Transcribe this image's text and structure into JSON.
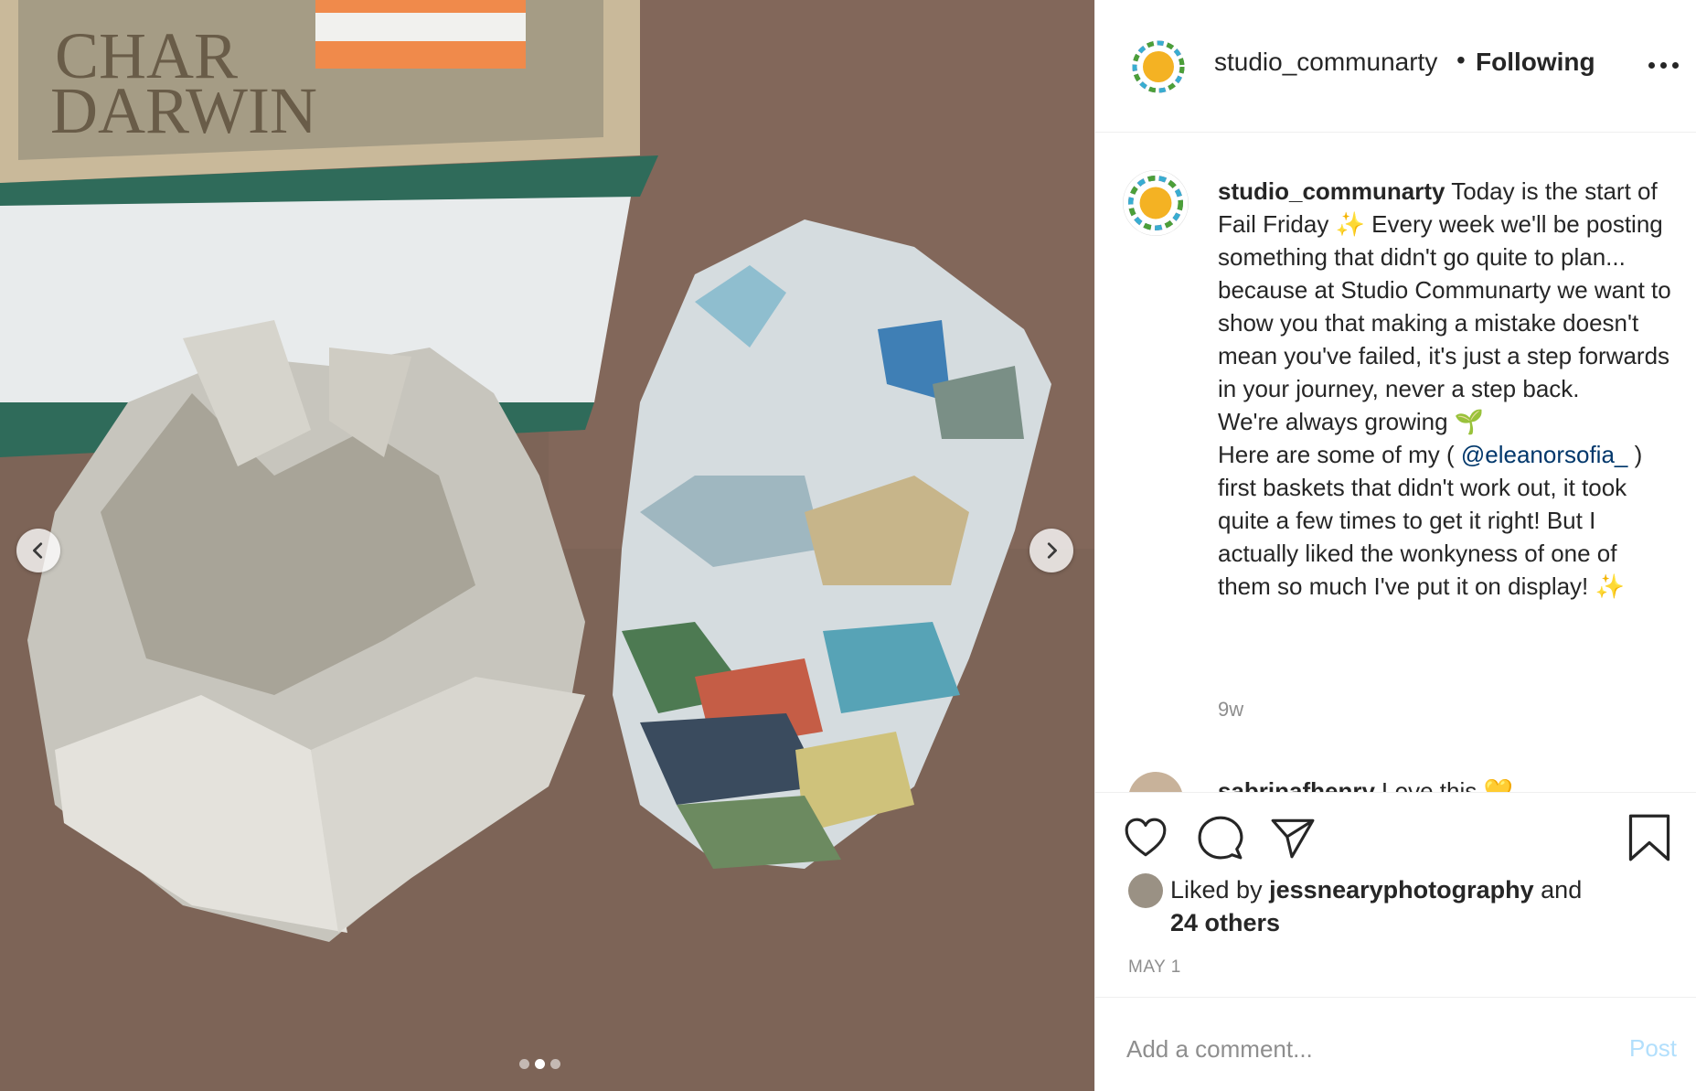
{
  "post": {
    "username": "studio_communarty",
    "separator": "•",
    "follow_status": "Following",
    "caption_lines": [
      "Today is the start of Fail Friday ✨ Every week we'll be posting something that didn't go quite to plan... because at Studio Communarty we want to show you that making a mistake doesn't mean you've failed, it's just a step forwards in your journey, never a step back.",
      "We're always growing 🌱"
    ],
    "caption_part2_before": "Here are some of my ( ",
    "caption_mention": "@eleanorsofia_",
    "caption_part2_after": " ) first baskets that didn't work out, it took quite a few times to get it right! But I actually liked the wonkyness of one of them so much I've put it on display! ✨",
    "time_ago": "9w",
    "comment_preview_user": "sabrinafhenry",
    "comment_preview_text": " Love this 💛",
    "liked_by_prefix": "Liked by ",
    "liked_by_user": "jessnearyphotography",
    "liked_by_suffix": " and",
    "liked_by_others": "24 others",
    "date": "MAY 1",
    "comment_placeholder": "Add a comment...",
    "post_button": "Post"
  },
  "photo": {
    "book_text_line1": "CHAR",
    "book_text_line2": "DARWIN",
    "carousel_count": 3,
    "carousel_active": 2
  },
  "icons": {
    "prev": "chevron-left-icon",
    "next": "chevron-right-icon",
    "more": "more-options-icon",
    "like": "heart-icon",
    "comment": "comment-bubble-icon",
    "share": "paper-plane-icon",
    "save": "bookmark-icon"
  },
  "colors": {
    "brand_logo_center": "#f4b223",
    "link": "#00376b",
    "muted": "#8e8e8e",
    "post_button": "#b2dffc"
  }
}
